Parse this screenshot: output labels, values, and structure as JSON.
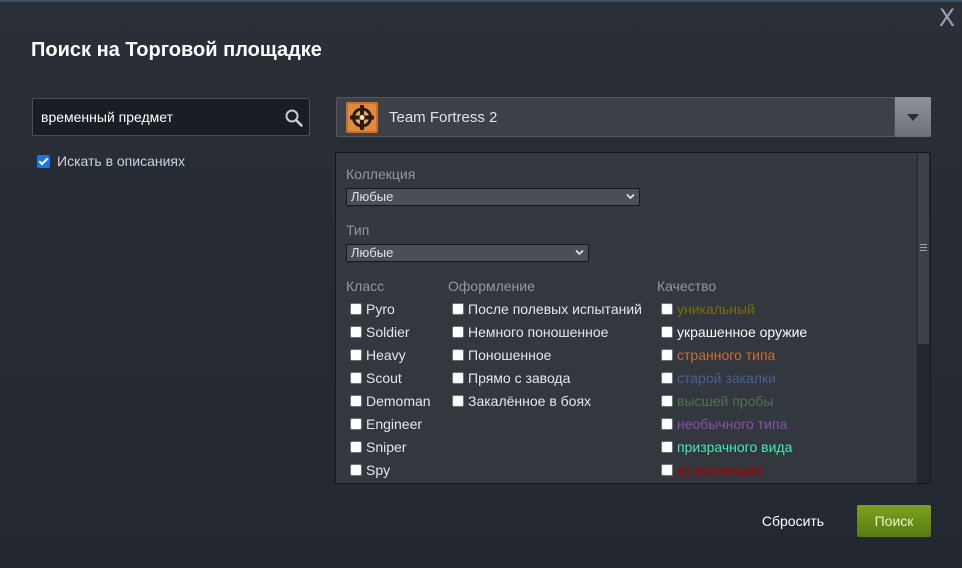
{
  "dialog": {
    "title": "Поиск на Торговой площадке",
    "close_label": "X"
  },
  "search": {
    "value": "временный предмет",
    "in_descriptions_label": "Искать в описаниях",
    "in_descriptions_checked": true
  },
  "game": {
    "name": "Team Fortress 2",
    "icon": "tf2-logo-icon"
  },
  "filters": {
    "collection": {
      "label": "Коллекция",
      "selected": "Любые"
    },
    "type": {
      "label": "Тип",
      "selected": "Любые"
    },
    "class": {
      "label": "Класс",
      "options": [
        "Pyro",
        "Soldier",
        "Heavy",
        "Scout",
        "Demoman",
        "Engineer",
        "Sniper",
        "Spy"
      ]
    },
    "exterior": {
      "label": "Оформление",
      "options": [
        "После полевых испытаний",
        "Немного поношенное",
        "Поношенное",
        "Прямо с завода",
        "Закалённое в боях"
      ]
    },
    "quality": {
      "label": "Качество",
      "options": [
        {
          "label": "уникальный",
          "color": "#7d6d00"
        },
        {
          "label": "украшенное оружие",
          "color": "#fafafa"
        },
        {
          "label": "странного типа",
          "color": "#cf6a32"
        },
        {
          "label": "старой закалки",
          "color": "#476291"
        },
        {
          "label": "высшей пробы",
          "color": "#4d7455"
        },
        {
          "label": "необычного типа",
          "color": "#8650ac"
        },
        {
          "label": "призрачного вида",
          "color": "#38f3ab"
        },
        {
          "label": "из коллекции",
          "color": "#aa0000"
        }
      ]
    }
  },
  "buttons": {
    "reset": "Сбросить",
    "search": "Поиск"
  }
}
